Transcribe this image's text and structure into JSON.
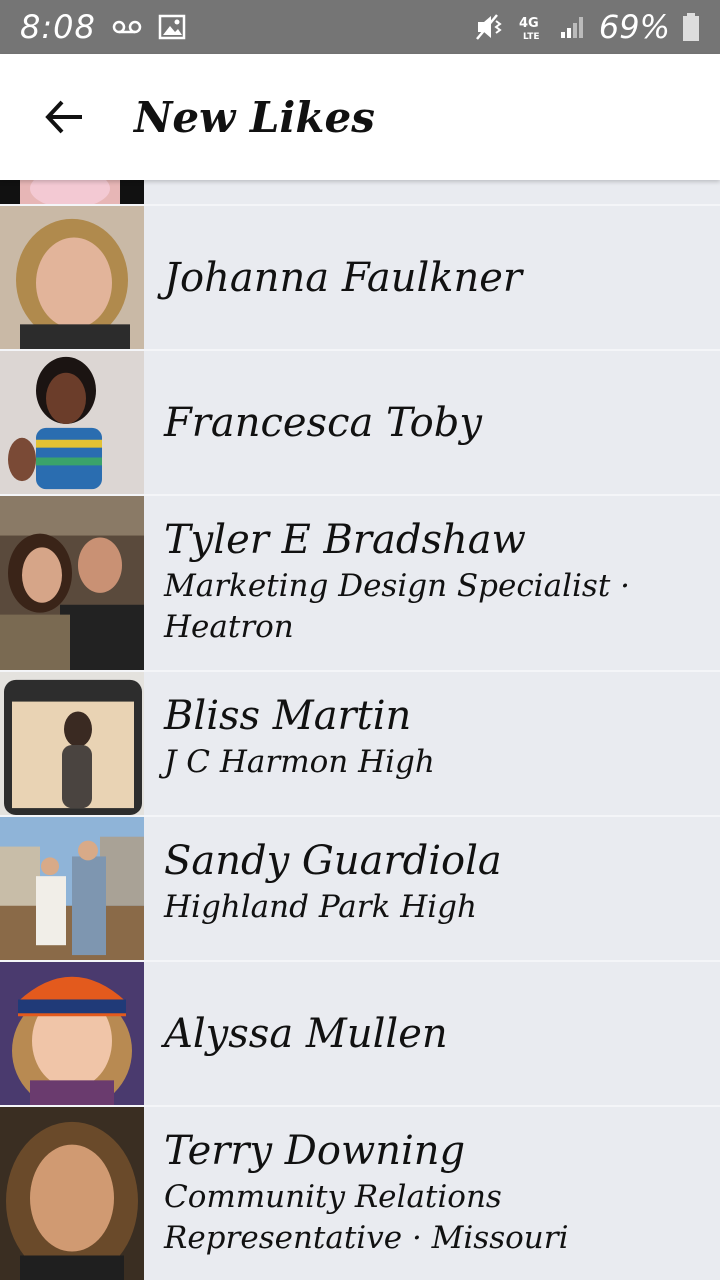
{
  "status_bar": {
    "time": "8:08",
    "battery": "69%",
    "network": "4G LTE"
  },
  "header": {
    "title": "New Likes",
    "back_icon": "arrow-left-icon"
  },
  "likes": [
    {
      "name": "Johanna Faulkner",
      "subtitle": ""
    },
    {
      "name": "Francesca Toby",
      "subtitle": ""
    },
    {
      "name": "Tyler E Bradshaw",
      "subtitle": "Marketing Design Specialist · Heatron"
    },
    {
      "name": "Bliss Martin",
      "subtitle": "J C Harmon High"
    },
    {
      "name": "Sandy Guardiola",
      "subtitle": "Highland Park High"
    },
    {
      "name": "Alyssa Mullen",
      "subtitle": ""
    },
    {
      "name": "Terry Downing",
      "subtitle": "Community Relations Representative · Missouri"
    }
  ],
  "colors": {
    "status_bar": "#757575",
    "app_bar": "#ffffff",
    "list_bg": "#e9ebf0"
  }
}
